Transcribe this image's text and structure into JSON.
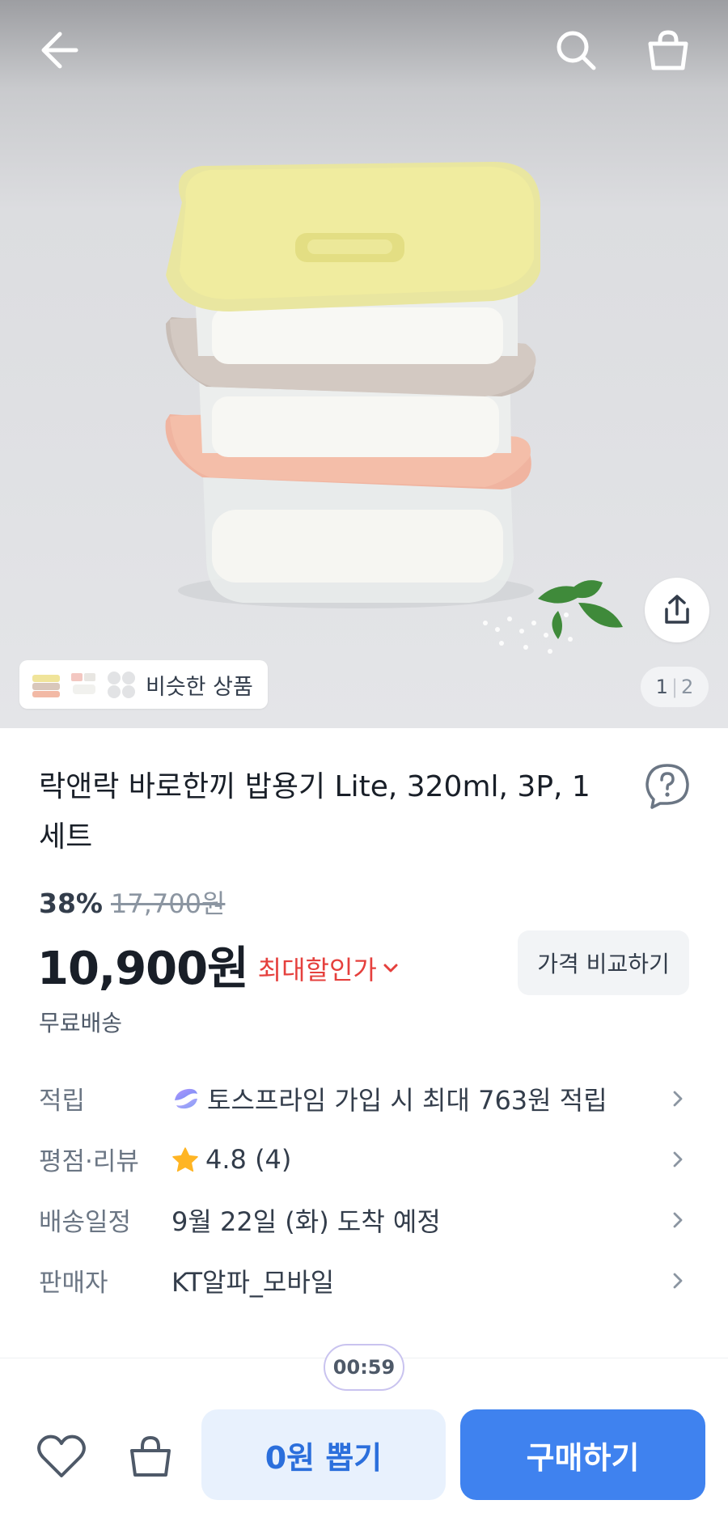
{
  "similar": {
    "label": "비슷한 상품"
  },
  "pager": {
    "current": "1",
    "total": "2"
  },
  "product": {
    "title": "락앤락 바로한끼 밥용기 Lite, 320ml, 3P, 1세트",
    "discount": "38%",
    "original_price": "17,700원",
    "price": "10,900원",
    "max_discount_label": "최대할인가",
    "compare_label": "가격 비교하기",
    "shipping": "무료배송"
  },
  "info": {
    "rows": [
      {
        "key": "적립",
        "value": "토스프라임 가입 시 최대 763원 적립",
        "icon": "toss-prime-icon"
      },
      {
        "key": "평점·리뷰",
        "value": "4.8 (4)",
        "icon": "star-icon"
      },
      {
        "key": "배송일정",
        "value": "9월 22일 (화) 도착 예정"
      },
      {
        "key": "판매자",
        "value": "KT알파_모바일"
      }
    ]
  },
  "bottom": {
    "timer": "00:59",
    "draw_label": "0원 뽑기",
    "buy_label": "구매하기"
  },
  "colors": {
    "accent_blue": "#3f82ef",
    "draw_bg": "#e8f1fd",
    "discount_red": "#e5403d",
    "star": "#ffb524"
  }
}
